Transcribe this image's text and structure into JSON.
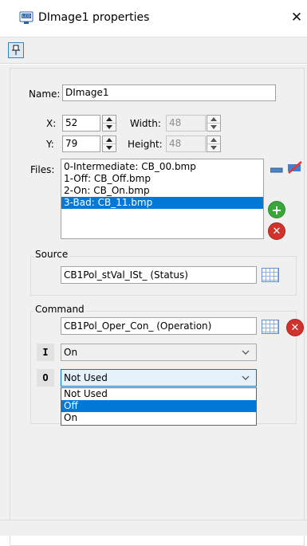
{
  "window": {
    "title": "DImage1 properties",
    "close_glyph": "✕",
    "pin_glyph": "📌"
  },
  "form": {
    "name_label": "Name:",
    "name_value": "DImage1",
    "x_label": "X:",
    "x_value": "52",
    "y_label": "Y:",
    "y_value": "79",
    "width_label": "Width:",
    "width_value": "48",
    "height_label": "Height:",
    "height_value": "48",
    "files_label": "Files:",
    "files": [
      {
        "text": "0-Intermediate: CB_00.bmp",
        "selected": false
      },
      {
        "text": "1-Off: CB_Off.bmp",
        "selected": false
      },
      {
        "text": "2-On: CB_On.bmp",
        "selected": false
      },
      {
        "text": "3-Bad: CB_11.bmp",
        "selected": true
      }
    ]
  },
  "source": {
    "label": "Source",
    "value": "CB1Pol_stVal_ISt_ (Status)"
  },
  "command": {
    "label": "Command",
    "value": "CB1Pol_Oper_Con_ (Operation)",
    "i_letter": "I",
    "i_value": "On",
    "o_letter": "O",
    "o_value": "Not Used",
    "dropdown_options": [
      {
        "text": "Not Used",
        "selected": false
      },
      {
        "text": "Off",
        "selected": true
      },
      {
        "text": "On",
        "selected": false
      }
    ]
  },
  "colors": {
    "selection": "#0078d7",
    "panel": "#f0f0f0",
    "accent_blue": "#3399ff",
    "add_green": "#3aa63a",
    "remove_red": "#d0322c"
  },
  "icons": {
    "add": "+",
    "remove": "✕"
  }
}
